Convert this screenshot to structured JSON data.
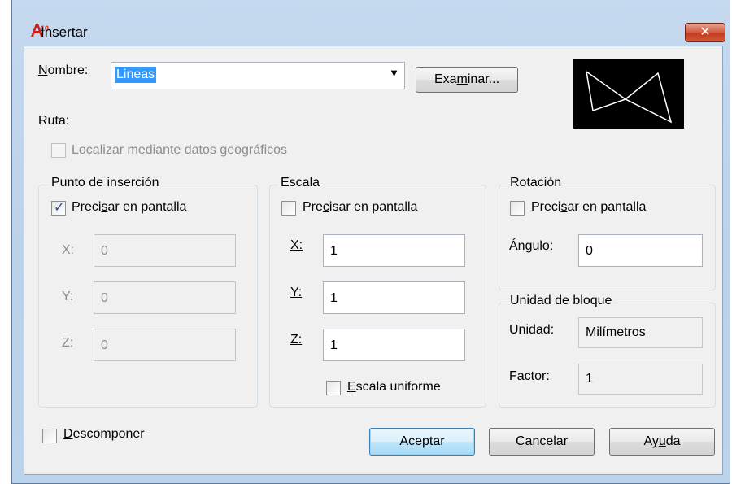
{
  "window": {
    "title": "Insertar",
    "app_icon_text": "A10",
    "close_label": "✕"
  },
  "name_row": {
    "label_pre": "",
    "label_u": "N",
    "label_post": "ombre:",
    "value": "Lineas",
    "browse_pre": "Exa",
    "browse_u": "m",
    "browse_post": "inar..."
  },
  "path": {
    "label": "Ruta:"
  },
  "geo": {
    "label_u": "L",
    "label_post": "ocalizar mediante datos geográficos"
  },
  "insertion_point": {
    "title": "Punto de inserción",
    "onscreen_pre": "Preci",
    "onscreen_u": "s",
    "onscreen_post": "ar en pantalla",
    "x_label": "X:",
    "x_value": "0",
    "y_label": "Y:",
    "y_value": "0",
    "z_label": "Z:",
    "z_value": "0"
  },
  "scale": {
    "title": "Escala",
    "onscreen_pre": "Pre",
    "onscreen_u": "c",
    "onscreen_post": "isar en pantalla",
    "x_label": "X:",
    "x_value": "1",
    "y_label": "Y:",
    "y_value": "1",
    "z_label": "Z:",
    "z_value": "1",
    "uniform_u": "E",
    "uniform_post": "scala uniforme"
  },
  "rotation": {
    "title": "Rotación",
    "onscreen_pre": "Preci",
    "onscreen_u": "s",
    "onscreen_post": "ar en pantalla",
    "angle_pre": "Ángul",
    "angle_u": "o",
    "angle_post": ":",
    "angle_value": "0"
  },
  "block_unit": {
    "title": "Unidad de bloque",
    "unit_label": "Unidad:",
    "unit_value": "Milímetros",
    "factor_label": "Factor:",
    "factor_value": "1"
  },
  "explode": {
    "label_u": "D",
    "label_post": "escomponer"
  },
  "buttons": {
    "ok": "Aceptar",
    "cancel": "Cancelar",
    "help_pre": "Ay",
    "help_u": "u",
    "help_post": "da"
  }
}
